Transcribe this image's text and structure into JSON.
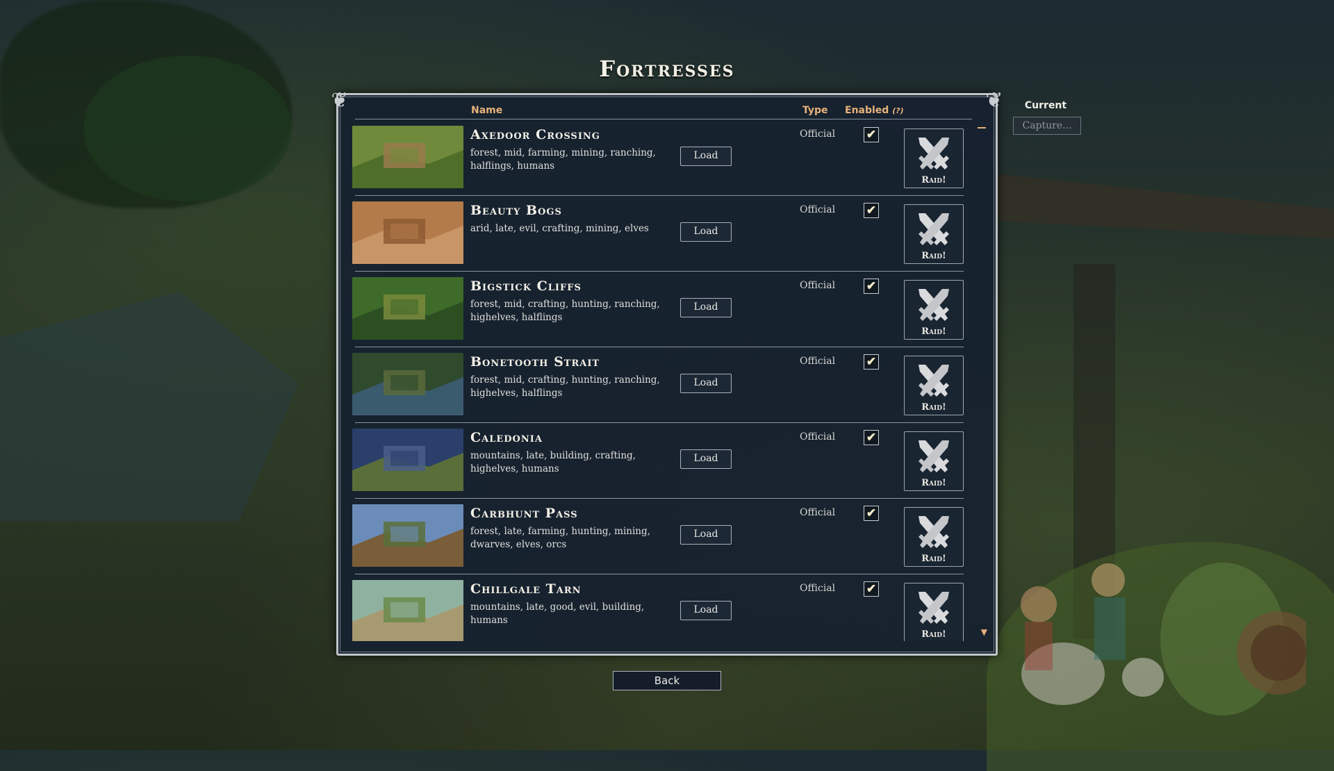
{
  "page": {
    "title": "Fortresses"
  },
  "columns": {
    "name": "Name",
    "type": "Type",
    "enabled": "Enabled",
    "enabled_help": "(?)"
  },
  "fortresses": [
    {
      "name": "Axedoor Crossing",
      "tags": "forest, mid, farming, mining, ranching, halflings, humans",
      "type": "Official",
      "enabled": true,
      "load_label": "Load",
      "raid_label": "Raid!",
      "thumb_colors": [
        "#6f8a3a",
        "#9a7a4c",
        "#4f6e2a"
      ]
    },
    {
      "name": "Beauty Bogs",
      "tags": "arid, late, evil, crafting, mining, elves",
      "type": "Official",
      "enabled": true,
      "load_label": "Load",
      "raid_label": "Raid!",
      "thumb_colors": [
        "#b37a4a",
        "#8d5a33",
        "#c89566"
      ]
    },
    {
      "name": "Bigstick Cliffs",
      "tags": "forest, mid, crafting, hunting, ranching, highelves, halflings",
      "type": "Official",
      "enabled": true,
      "load_label": "Load",
      "raid_label": "Raid!",
      "thumb_colors": [
        "#3f6b2a",
        "#7a8a3c",
        "#2c4f22"
      ]
    },
    {
      "name": "Bonetooth Strait",
      "tags": "forest, mid, crafting, hunting, ranching, highelves, halflings",
      "type": "Official",
      "enabled": true,
      "load_label": "Load",
      "raid_label": "Raid!",
      "thumb_colors": [
        "#2f4a2c",
        "#5b6a3a",
        "#3a5b6e"
      ]
    },
    {
      "name": "Caledonia",
      "tags": "mountains, late, building, crafting, highelves, humans",
      "type": "Official",
      "enabled": true,
      "load_label": "Load",
      "raid_label": "Raid!",
      "thumb_colors": [
        "#2a3f6a",
        "#4a5e8a",
        "#5a6e3a"
      ]
    },
    {
      "name": "Carbhunt Pass",
      "tags": "forest, late, farming, hunting, mining, dwarves, elves, orcs",
      "type": "Official",
      "enabled": true,
      "load_label": "Load",
      "raid_label": "Raid!",
      "thumb_colors": [
        "#6b8cb8",
        "#5a6e3a",
        "#7a5e3a"
      ]
    },
    {
      "name": "Chillgale Tarn",
      "tags": "mountains, late, good, evil, building, humans",
      "type": "Official",
      "enabled": true,
      "load_label": "Load",
      "raid_label": "Raid!",
      "thumb_colors": [
        "#8fb2a0",
        "#6a8a4a",
        "#a89a70"
      ]
    }
  ],
  "current": {
    "label": "Current",
    "value": "Capture..."
  },
  "footer": {
    "back_label": "Back"
  },
  "icons": {
    "raid": "crossed-swords-icon",
    "check": "checkmark-icon",
    "scroll_down": "triangle-down-icon"
  }
}
